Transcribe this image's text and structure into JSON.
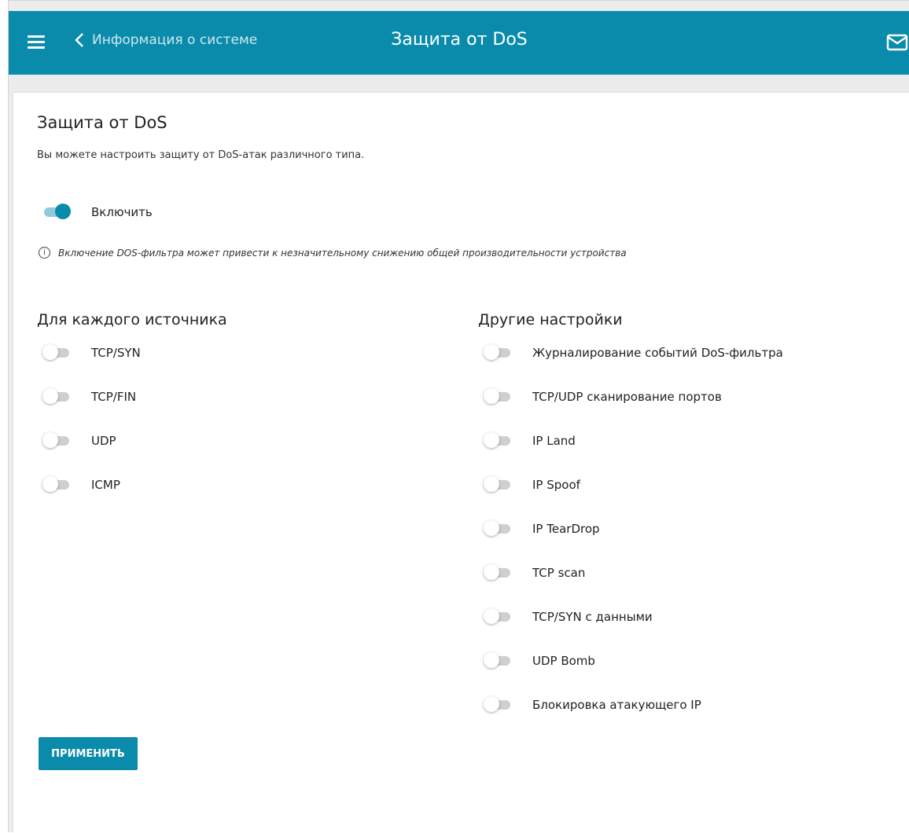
{
  "header": {
    "back_label": "Информация о системе",
    "title": "Защита от DoS"
  },
  "card": {
    "title": "Защита от DoS",
    "description": "Вы можете настроить защиту от DoS-атак различного типа.",
    "enable_label": "Включить",
    "enable_state": true,
    "note": "Включение DOS-фильтра может привести к незначительному снижению общей производительности устройства"
  },
  "per_source": {
    "title": "Для каждого источника",
    "items": [
      {
        "label": "TCP/SYN",
        "on": false
      },
      {
        "label": "TCP/FIN",
        "on": false
      },
      {
        "label": "UDP",
        "on": false
      },
      {
        "label": "ICMP",
        "on": false
      }
    ]
  },
  "other": {
    "title": "Другие настройки",
    "items": [
      {
        "label": "Журналирование событий DoS-фильтра",
        "on": false
      },
      {
        "label": "TCP/UDP сканирование портов",
        "on": false
      },
      {
        "label": "IP Land",
        "on": false
      },
      {
        "label": "IP Spoof",
        "on": false
      },
      {
        "label": "IP TearDrop",
        "on": false
      },
      {
        "label": "TCP scan",
        "on": false
      },
      {
        "label": "TCP/SYN с данными",
        "on": false
      },
      {
        "label": "UDP Bomb",
        "on": false
      },
      {
        "label": "Блокировка атакующего IP",
        "on": false
      }
    ]
  },
  "apply_label": "ПРИМЕНИТЬ",
  "colors": {
    "accent": "#0b8bab",
    "toggle_off_track": "#cfcfcf",
    "toggle_on_track": "#8fcadb"
  }
}
